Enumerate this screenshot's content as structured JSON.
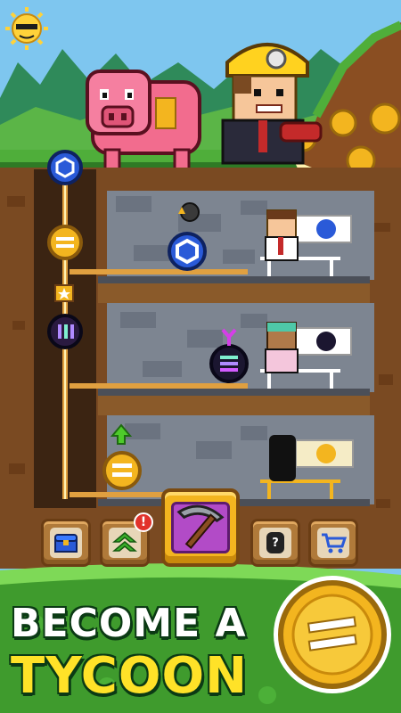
{
  "promo": {
    "headline_line1": "BECOME A",
    "headline_line2": "TYCOON"
  },
  "icons": {
    "sun": "sun-icon",
    "pig": "piggy-bank-icon",
    "miner": "miner-character-icon",
    "coin_small": "gold-coin-icon",
    "toolbar": [
      "treasure-chest-icon",
      "upgrade-chevrons-icon",
      "pickaxe-icon",
      "mystery-character-icon",
      "shopping-cart-icon"
    ]
  },
  "notifications": {
    "upgrade_alert": "!"
  },
  "floors": [
    {
      "token": "chainlink-token",
      "level_icon": "coin-stack-icon",
      "manager": "brown-hair-manager"
    },
    {
      "token": "solana-token",
      "level_icon": "branch-icon",
      "manager": "green-hair-manager"
    },
    {
      "token": "dollar-token",
      "level_icon": "up-arrow-icon",
      "manager": "locked-silhouette"
    }
  ],
  "elevator": {
    "tokens": [
      "chainlink-token",
      "dollar-token",
      "star-box",
      "numeraire-token"
    ]
  },
  "colors": {
    "sky": "#7ec6ef",
    "grass": "#4fae3a",
    "dirt": "#7a4a22",
    "stone": "#7d8591",
    "gold": "#f3b51f",
    "headline_yellow": "#ffe228",
    "promo_green": "#3f9b2d"
  }
}
